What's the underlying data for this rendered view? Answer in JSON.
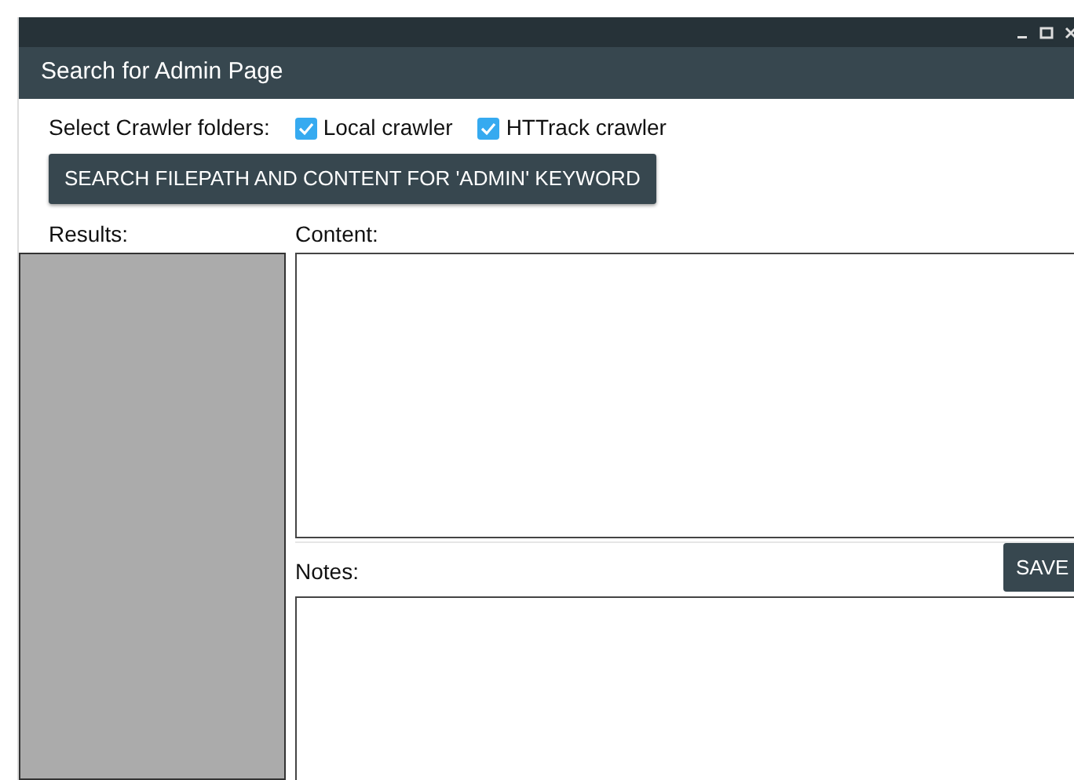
{
  "window": {
    "title": "Search for Admin Page"
  },
  "crawler_folders": {
    "label": "Select Crawler folders:",
    "options": [
      {
        "label": "Local crawler",
        "checked": true
      },
      {
        "label": "HTTrack crawler",
        "checked": true
      }
    ]
  },
  "search_button": "SEARCH FILEPATH AND CONTENT FOR 'ADMIN' KEYWORD",
  "results": {
    "label": "Results:"
  },
  "content": {
    "label": "Content:"
  },
  "notes": {
    "label": "Notes:",
    "save_button": "SAVE"
  }
}
